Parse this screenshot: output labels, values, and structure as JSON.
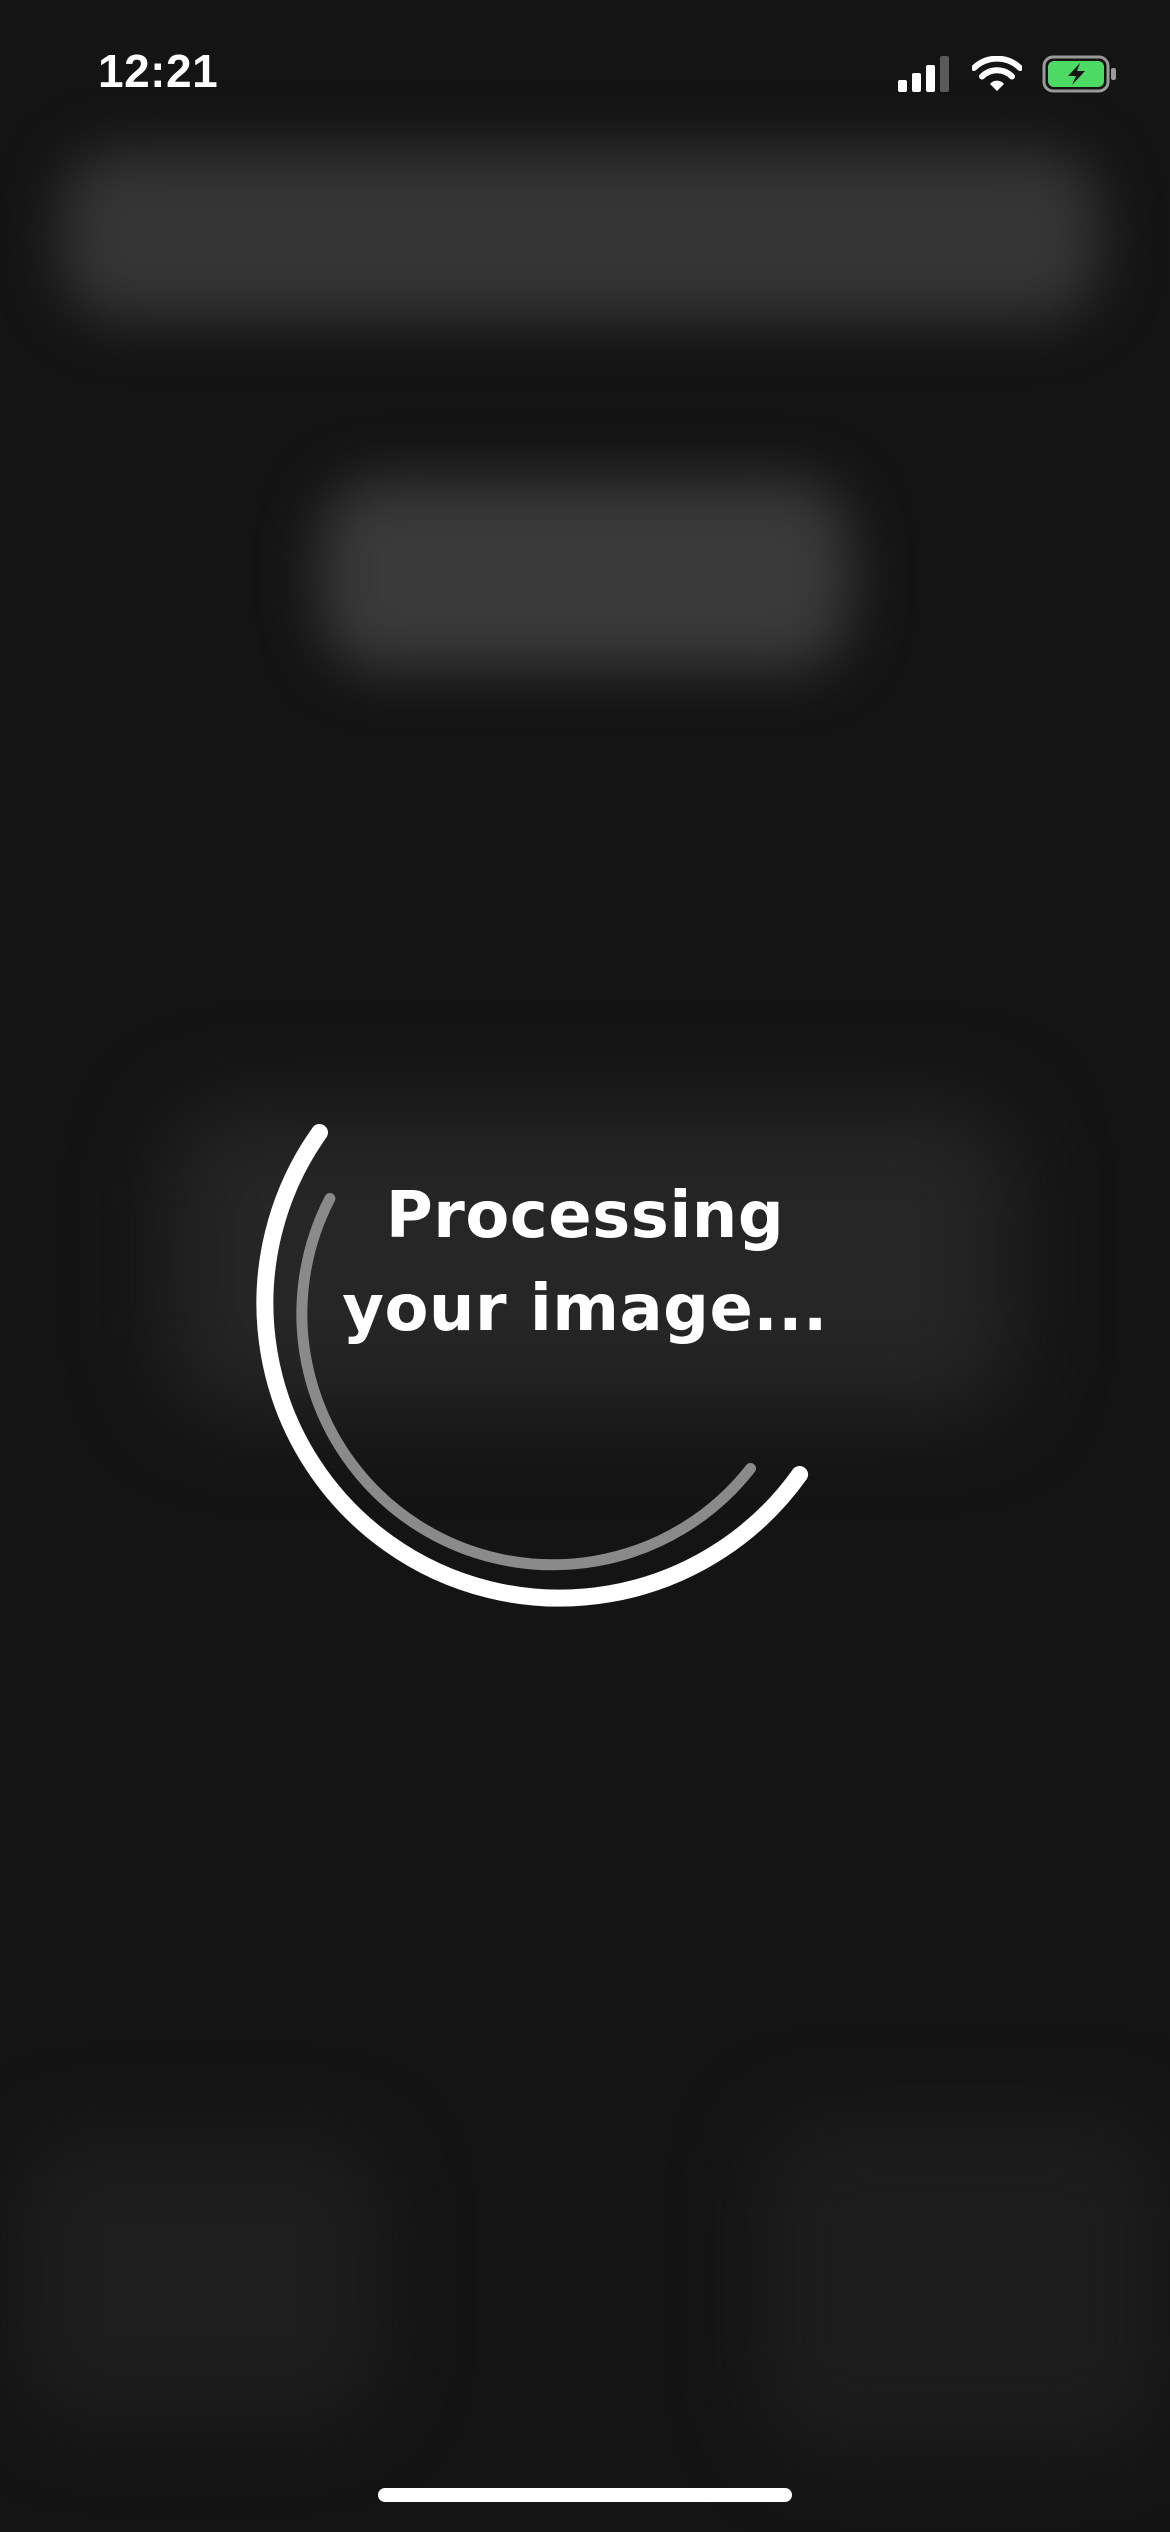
{
  "status_bar": {
    "time": "12:21",
    "icons": [
      "cellular-signal-icon",
      "wifi-icon",
      "battery-charging-icon"
    ],
    "battery_color": "#4cd964"
  },
  "loader": {
    "line1": "Processing",
    "line2": "your image..."
  },
  "colors": {
    "background": "#141414",
    "primary_arc": "#ffffff",
    "secondary_arc": "#8a8a8a"
  }
}
